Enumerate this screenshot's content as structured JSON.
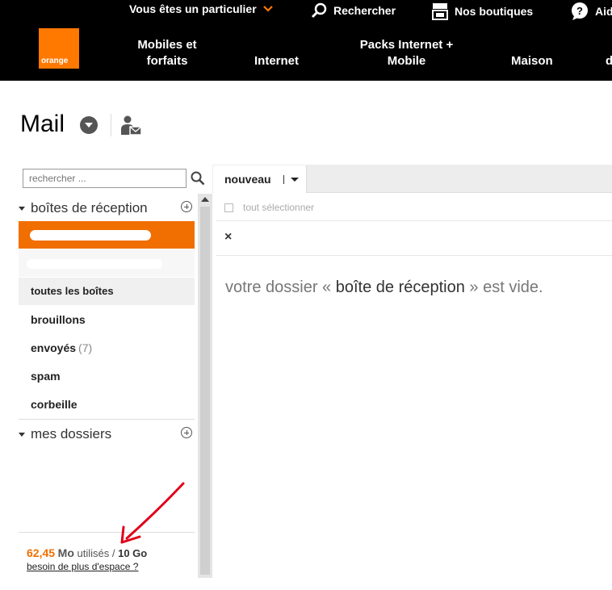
{
  "topbar": {
    "particulier": "Vous êtes un particulier",
    "search": "Rechercher",
    "shops": "Nos boutiques",
    "help": "Aid"
  },
  "logo": {
    "text": "orange"
  },
  "nav": {
    "mobiles": "Mobiles et forfaits",
    "internet": "Internet",
    "packs": "Packs Internet + Mobile",
    "maison": "Maison",
    "cut": "d"
  },
  "app": {
    "title": "Mail"
  },
  "search": {
    "placeholder": "rechercher ..."
  },
  "sidebar": {
    "inboxes_label": "boîtes de réception",
    "all_boxes": "toutes les boîtes",
    "folders": [
      {
        "label": "brouillons",
        "count": ""
      },
      {
        "label": "envoyés",
        "count": "(7)"
      },
      {
        "label": "spam",
        "count": ""
      },
      {
        "label": "corbeille",
        "count": ""
      }
    ],
    "my_folders_label": "mes dossiers"
  },
  "quota": {
    "used": "62,45",
    "used_unit": "Mo",
    "used_word": "utilisés /",
    "total": "10 Go",
    "more_link": "besoin de plus d'espace ?"
  },
  "toolbar": {
    "new_label": "nouveau"
  },
  "list": {
    "select_all": "tout sélectionner",
    "close": "×",
    "empty_prefix": "votre dossier «",
    "empty_folder": "boîte de réception",
    "empty_suffix": "» est vide."
  },
  "colors": {
    "brand": "#ff7900",
    "selected": "#f16e00",
    "annotation": "#e0001a"
  }
}
